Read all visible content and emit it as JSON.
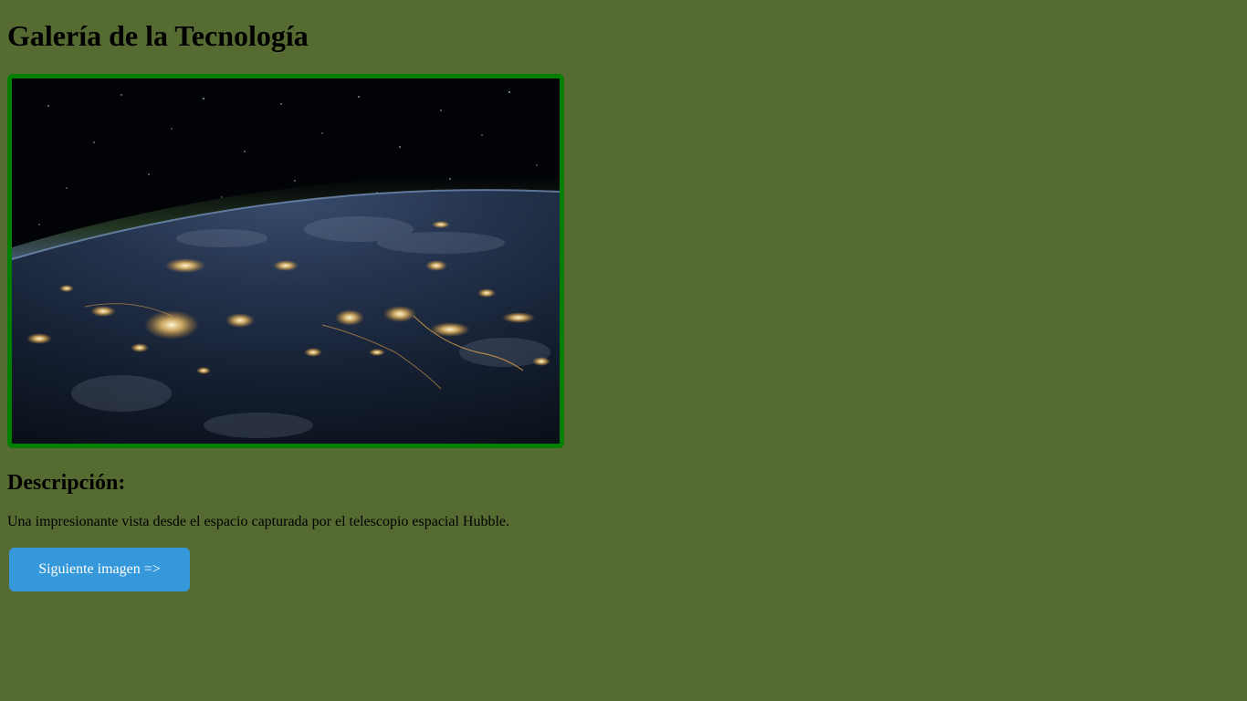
{
  "gallery": {
    "title": "Galería de la Tecnología",
    "image": {
      "subject": "earth-night-from-space",
      "border_color": "#008000"
    },
    "description_heading": "Descripción:",
    "description_text": "Una impresionante vista desde el espacio capturada por el telescopio espacial Hubble.",
    "next_button_label": "Siguiente imagen =>"
  },
  "colors": {
    "background": "#566b31",
    "button": "#3498db",
    "button_text": "#ffffff"
  }
}
